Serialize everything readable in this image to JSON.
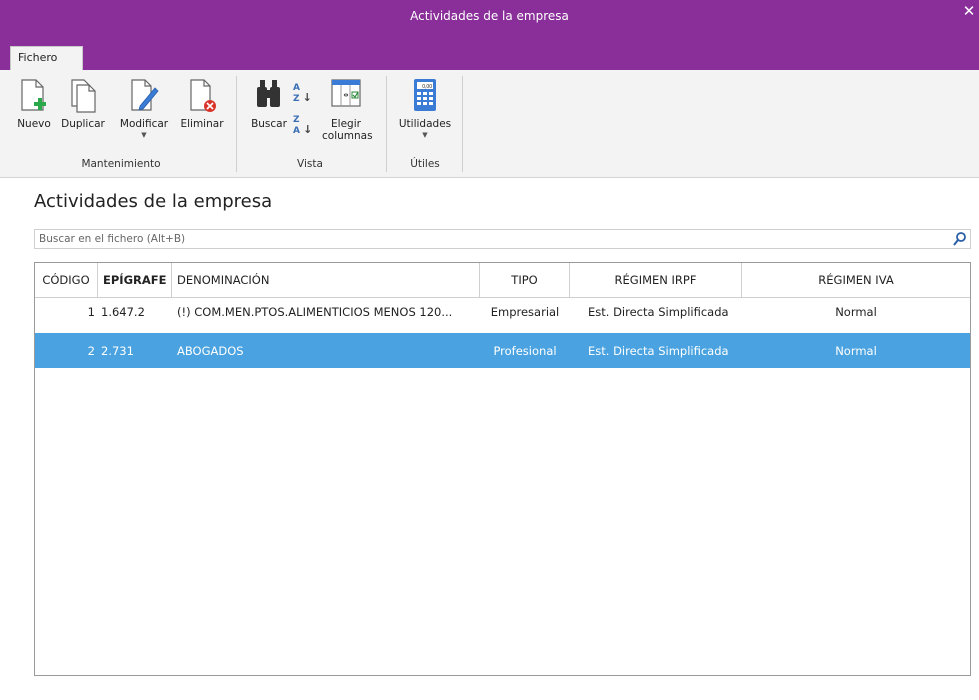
{
  "window": {
    "title": "Actividades de la empresa",
    "close_glyph": "✕"
  },
  "ribbon": {
    "tab": "Fichero",
    "groups": {
      "mantenimiento": "Mantenimiento",
      "vista": "Vista",
      "utiles": "Útiles"
    },
    "buttons": {
      "nuevo": "Nuevo",
      "duplicar": "Duplicar",
      "modificar": "Modificar",
      "eliminar": "Eliminar",
      "buscar": "Buscar",
      "elegir_1": "Elegir",
      "elegir_2": "columnas",
      "utilidades": "Utilidades"
    },
    "calc_display": "0,00"
  },
  "page": {
    "title": "Actividades de la empresa",
    "search_placeholder": "Buscar en el fichero (Alt+B)"
  },
  "table": {
    "columns": [
      "CÓDIGO",
      "EPÍGRAFE",
      "DENOMINACIÓN",
      "TIPO",
      "RÉGIMEN IRPF",
      "RÉGIMEN IVA"
    ],
    "rows": [
      [
        "1",
        "1.647.2",
        "(!) COM.MEN.PTOS.ALIMENTICIOS MENOS 120...",
        "Empresarial",
        "Est. Directa Simplificada",
        "Normal"
      ],
      [
        "2",
        "2.731",
        "ABOGADOS",
        "Profesional",
        "Est. Directa Simplificada",
        "Normal"
      ]
    ],
    "selected_row": 1
  },
  "colors": {
    "accent": "#8a2f9a",
    "selection": "#4aa3e0",
    "ribbon_bg": "#f3f3f3"
  }
}
